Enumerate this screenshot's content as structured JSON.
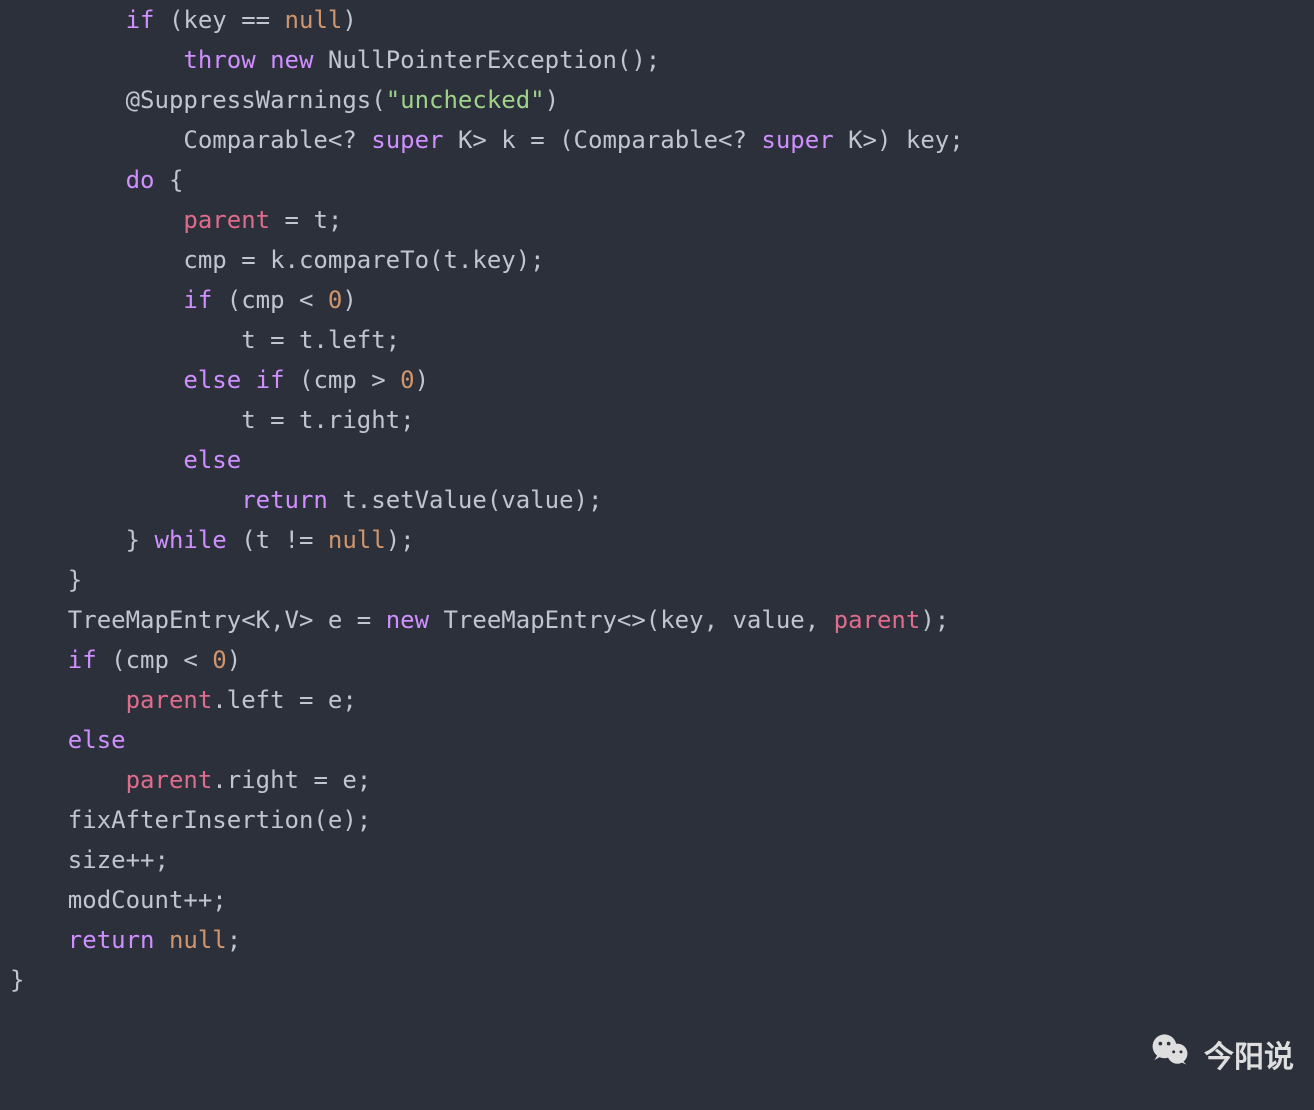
{
  "code": {
    "indent_unit": "    ",
    "lines": [
      {
        "indent": 2,
        "tokens": [
          {
            "t": "kw",
            "v": "if"
          },
          {
            "t": "p",
            "v": " (key == "
          },
          {
            "t": "null",
            "v": "null"
          },
          {
            "t": "p",
            "v": ")"
          }
        ]
      },
      {
        "indent": 3,
        "tokens": [
          {
            "t": "kw",
            "v": "throw"
          },
          {
            "t": "p",
            "v": " "
          },
          {
            "t": "kw",
            "v": "new"
          },
          {
            "t": "p",
            "v": " NullPointerException();"
          }
        ]
      },
      {
        "indent": 2,
        "tokens": [
          {
            "t": "ann",
            "v": "@SuppressWarnings"
          },
          {
            "t": "p",
            "v": "("
          },
          {
            "t": "str",
            "v": "\"unchecked\""
          },
          {
            "t": "p",
            "v": ")"
          }
        ]
      },
      {
        "indent": 3,
        "tokens": [
          {
            "t": "type",
            "v": "Comparable"
          },
          {
            "t": "p",
            "v": "<? "
          },
          {
            "t": "kw",
            "v": "super"
          },
          {
            "t": "p",
            "v": " K> k = (Comparable<? "
          },
          {
            "t": "kw",
            "v": "super"
          },
          {
            "t": "p",
            "v": " K>) key;"
          }
        ]
      },
      {
        "indent": 2,
        "tokens": [
          {
            "t": "kw",
            "v": "do"
          },
          {
            "t": "p",
            "v": " {"
          }
        ]
      },
      {
        "indent": 3,
        "tokens": [
          {
            "t": "var",
            "v": "parent"
          },
          {
            "t": "p",
            "v": " = t;"
          }
        ]
      },
      {
        "indent": 3,
        "tokens": [
          {
            "t": "p",
            "v": "cmp = k.compareTo(t.key);"
          }
        ]
      },
      {
        "indent": 3,
        "tokens": [
          {
            "t": "kw",
            "v": "if"
          },
          {
            "t": "p",
            "v": " (cmp < "
          },
          {
            "t": "num",
            "v": "0"
          },
          {
            "t": "p",
            "v": ")"
          }
        ]
      },
      {
        "indent": 4,
        "tokens": [
          {
            "t": "p",
            "v": "t = t.left;"
          }
        ]
      },
      {
        "indent": 3,
        "tokens": [
          {
            "t": "kw",
            "v": "else"
          },
          {
            "t": "p",
            "v": " "
          },
          {
            "t": "kw",
            "v": "if"
          },
          {
            "t": "p",
            "v": " (cmp > "
          },
          {
            "t": "num",
            "v": "0"
          },
          {
            "t": "p",
            "v": ")"
          }
        ]
      },
      {
        "indent": 4,
        "tokens": [
          {
            "t": "p",
            "v": "t = t.right;"
          }
        ]
      },
      {
        "indent": 3,
        "tokens": [
          {
            "t": "kw",
            "v": "else"
          }
        ]
      },
      {
        "indent": 4,
        "tokens": [
          {
            "t": "kw",
            "v": "return"
          },
          {
            "t": "p",
            "v": " t.setValue(value);"
          }
        ]
      },
      {
        "indent": 2,
        "tokens": [
          {
            "t": "p",
            "v": "} "
          },
          {
            "t": "kw",
            "v": "while"
          },
          {
            "t": "p",
            "v": " (t != "
          },
          {
            "t": "null",
            "v": "null"
          },
          {
            "t": "p",
            "v": ");"
          }
        ]
      },
      {
        "indent": 1,
        "tokens": [
          {
            "t": "p",
            "v": "}"
          }
        ]
      },
      {
        "indent": 1,
        "tokens": [
          {
            "t": "type",
            "v": "TreeMapEntry"
          },
          {
            "t": "p",
            "v": "<K,V> e = "
          },
          {
            "t": "kw",
            "v": "new"
          },
          {
            "t": "p",
            "v": " TreeMapEntry<>(key, value, "
          },
          {
            "t": "var",
            "v": "parent"
          },
          {
            "t": "p",
            "v": ");"
          }
        ]
      },
      {
        "indent": 1,
        "tokens": [
          {
            "t": "kw",
            "v": "if"
          },
          {
            "t": "p",
            "v": " (cmp < "
          },
          {
            "t": "num",
            "v": "0"
          },
          {
            "t": "p",
            "v": ")"
          }
        ]
      },
      {
        "indent": 2,
        "tokens": [
          {
            "t": "var",
            "v": "parent"
          },
          {
            "t": "p",
            "v": ".left = e;"
          }
        ]
      },
      {
        "indent": 1,
        "tokens": [
          {
            "t": "kw",
            "v": "else"
          }
        ]
      },
      {
        "indent": 2,
        "tokens": [
          {
            "t": "var",
            "v": "parent"
          },
          {
            "t": "p",
            "v": ".right = e;"
          }
        ]
      },
      {
        "indent": 1,
        "tokens": [
          {
            "t": "p",
            "v": "fixAfterInsertion(e);"
          }
        ]
      },
      {
        "indent": 1,
        "tokens": [
          {
            "t": "p",
            "v": "size++;"
          }
        ]
      },
      {
        "indent": 1,
        "tokens": [
          {
            "t": "p",
            "v": "modCount++;"
          }
        ]
      },
      {
        "indent": 1,
        "tokens": [
          {
            "t": "kw",
            "v": "return"
          },
          {
            "t": "p",
            "v": " "
          },
          {
            "t": "null",
            "v": "null"
          },
          {
            "t": "p",
            "v": ";"
          }
        ]
      },
      {
        "indent": 0,
        "tokens": [
          {
            "t": "p",
            "v": "}"
          }
        ]
      }
    ]
  },
  "watermark": {
    "text": "今阳说",
    "icon_name": "wechat-icon"
  }
}
